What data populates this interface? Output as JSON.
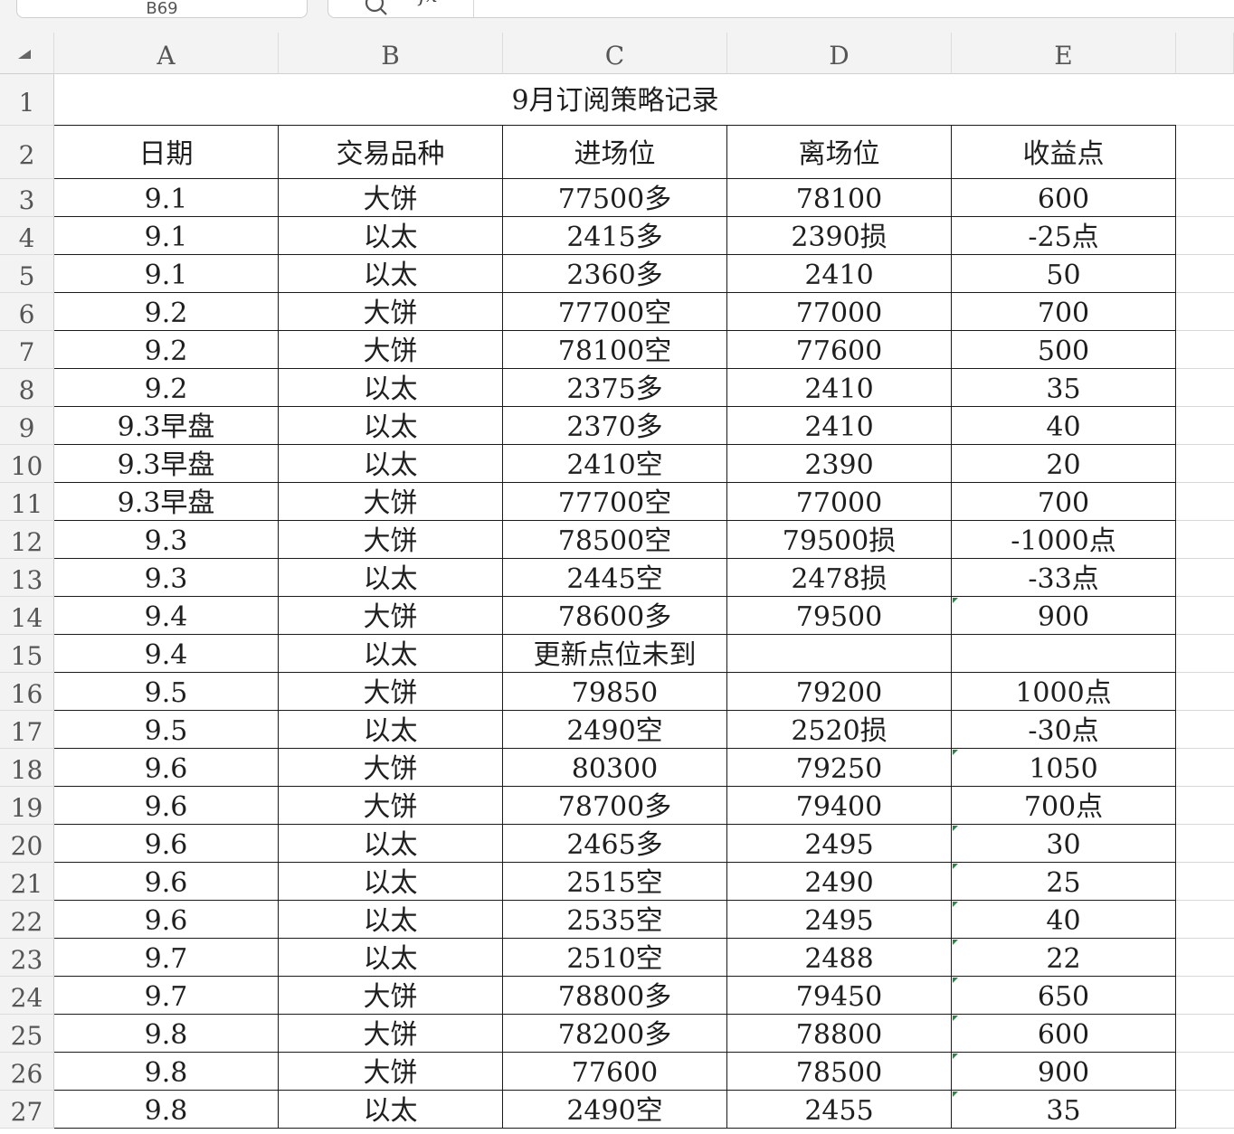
{
  "toolbar": {
    "name_box": "B69",
    "fx_label": "fx",
    "formula_value": ""
  },
  "columns": [
    "A",
    "B",
    "C",
    "D",
    "E"
  ],
  "sheet": {
    "title": "9月订阅策略记录",
    "headers": [
      "日期",
      "交易品种",
      "进场位",
      "离场位",
      "收益点"
    ],
    "rows": [
      {
        "row": "3",
        "cells": [
          "9.1",
          "大饼",
          "77500多",
          "78100",
          "600"
        ]
      },
      {
        "row": "4",
        "cells": [
          "9.1",
          "以太",
          "2415多",
          "2390损",
          "-25点"
        ]
      },
      {
        "row": "5",
        "cells": [
          "9.1",
          "以太",
          "2360多",
          "2410",
          "50"
        ]
      },
      {
        "row": "6",
        "cells": [
          "9.2",
          "大饼",
          "77700空",
          "77000",
          "700"
        ]
      },
      {
        "row": "7",
        "cells": [
          "9.2",
          "大饼",
          "78100空",
          "77600",
          "500"
        ]
      },
      {
        "row": "8",
        "cells": [
          "9.2",
          "以太",
          "2375多",
          "2410",
          "35"
        ]
      },
      {
        "row": "9",
        "cells": [
          "9.3早盘",
          "以太",
          "2370多",
          "2410",
          "40"
        ]
      },
      {
        "row": "10",
        "cells": [
          "9.3早盘",
          "以太",
          "2410空",
          "2390",
          "20"
        ]
      },
      {
        "row": "11",
        "cells": [
          "9.3早盘",
          "大饼",
          "77700空",
          "77000",
          "700"
        ]
      },
      {
        "row": "12",
        "cells": [
          "9.3",
          "大饼",
          "78500空",
          "79500损",
          "-1000点"
        ]
      },
      {
        "row": "13",
        "cells": [
          "9.3",
          "以太",
          "2445空",
          "2478损",
          "-33点"
        ]
      },
      {
        "row": "14",
        "cells": [
          "9.4",
          "大饼",
          "78600多",
          "79500",
          "900"
        ]
      },
      {
        "row": "15",
        "cells": [
          "9.4",
          "以太",
          "更新点位未到",
          "",
          ""
        ]
      },
      {
        "row": "16",
        "cells": [
          "9.5",
          "大饼",
          "79850",
          "79200",
          "1000点"
        ]
      },
      {
        "row": "17",
        "cells": [
          "9.5",
          "以太",
          "2490空",
          "2520损",
          "-30点"
        ]
      },
      {
        "row": "18",
        "cells": [
          "9.6",
          "大饼",
          "80300",
          "79250",
          "1050"
        ]
      },
      {
        "row": "19",
        "cells": [
          "9.6",
          "大饼",
          "78700多",
          "79400",
          "700点"
        ]
      },
      {
        "row": "20",
        "cells": [
          "9.6",
          "以太",
          "2465多",
          "2495",
          "30"
        ]
      },
      {
        "row": "21",
        "cells": [
          "9.6",
          "以太",
          "2515空",
          "2490",
          "25"
        ]
      },
      {
        "row": "22",
        "cells": [
          "9.6",
          "以太",
          "2535空",
          "2495",
          "40"
        ]
      },
      {
        "row": "23",
        "cells": [
          "9.7",
          "以太",
          "2510空",
          "2488",
          "22"
        ]
      },
      {
        "row": "24",
        "cells": [
          "9.7",
          "大饼",
          "78800多",
          "79450",
          "650"
        ]
      },
      {
        "row": "25",
        "cells": [
          "9.8",
          "大饼",
          "78200多",
          "78800",
          "600"
        ]
      },
      {
        "row": "26",
        "cells": [
          "9.8",
          "大饼",
          "77600",
          "78500",
          "900"
        ]
      },
      {
        "row": "27",
        "cells": [
          "9.8",
          "以太",
          "2490空",
          "2455",
          "35"
        ]
      }
    ]
  },
  "row_numbers": [
    "1",
    "2"
  ],
  "green_markers_rows": [
    "14",
    "18",
    "20",
    "21",
    "22",
    "23",
    "24",
    "25",
    "26",
    "27"
  ]
}
